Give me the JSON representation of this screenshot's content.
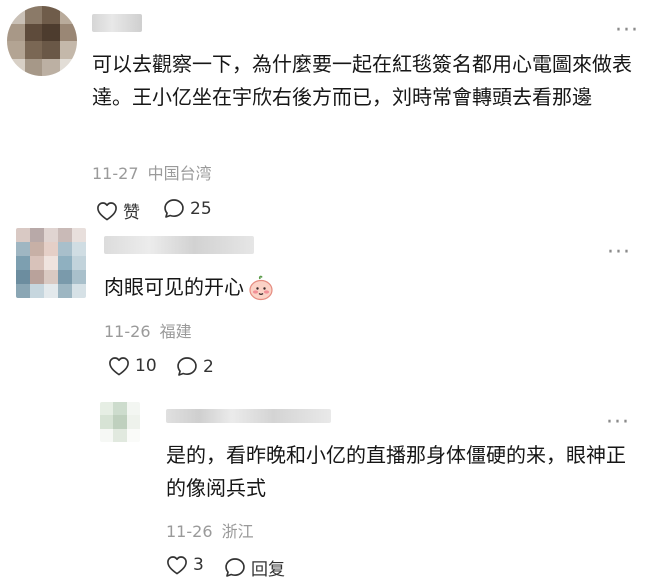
{
  "comments": [
    {
      "text": "可以去觀察一下，為什麼要一起在紅毯簽名都用心電圖來做表達。王小亿坐在宇欣右後方而已，刘時常會轉頭去看那邊",
      "date": "11-27",
      "location": "中国台湾",
      "like_label": "赞",
      "reply_count": "25"
    },
    {
      "text": "肉眼可见的开心",
      "emoji_icon": "blushing-face-emoji-icon",
      "date": "11-26",
      "location": "福建",
      "like_count": "10",
      "reply_count": "2"
    },
    {
      "text": "是的，看昨晚和小亿的直播那身体僵硬的来，眼神正的像阅兵式",
      "date": "11-26",
      "location": "浙江",
      "like_count": "3",
      "reply_label": "回复"
    }
  ],
  "icons": {
    "like": "heart-outline-icon",
    "reply": "speech-bubble-icon",
    "more": "more-dots-icon"
  }
}
